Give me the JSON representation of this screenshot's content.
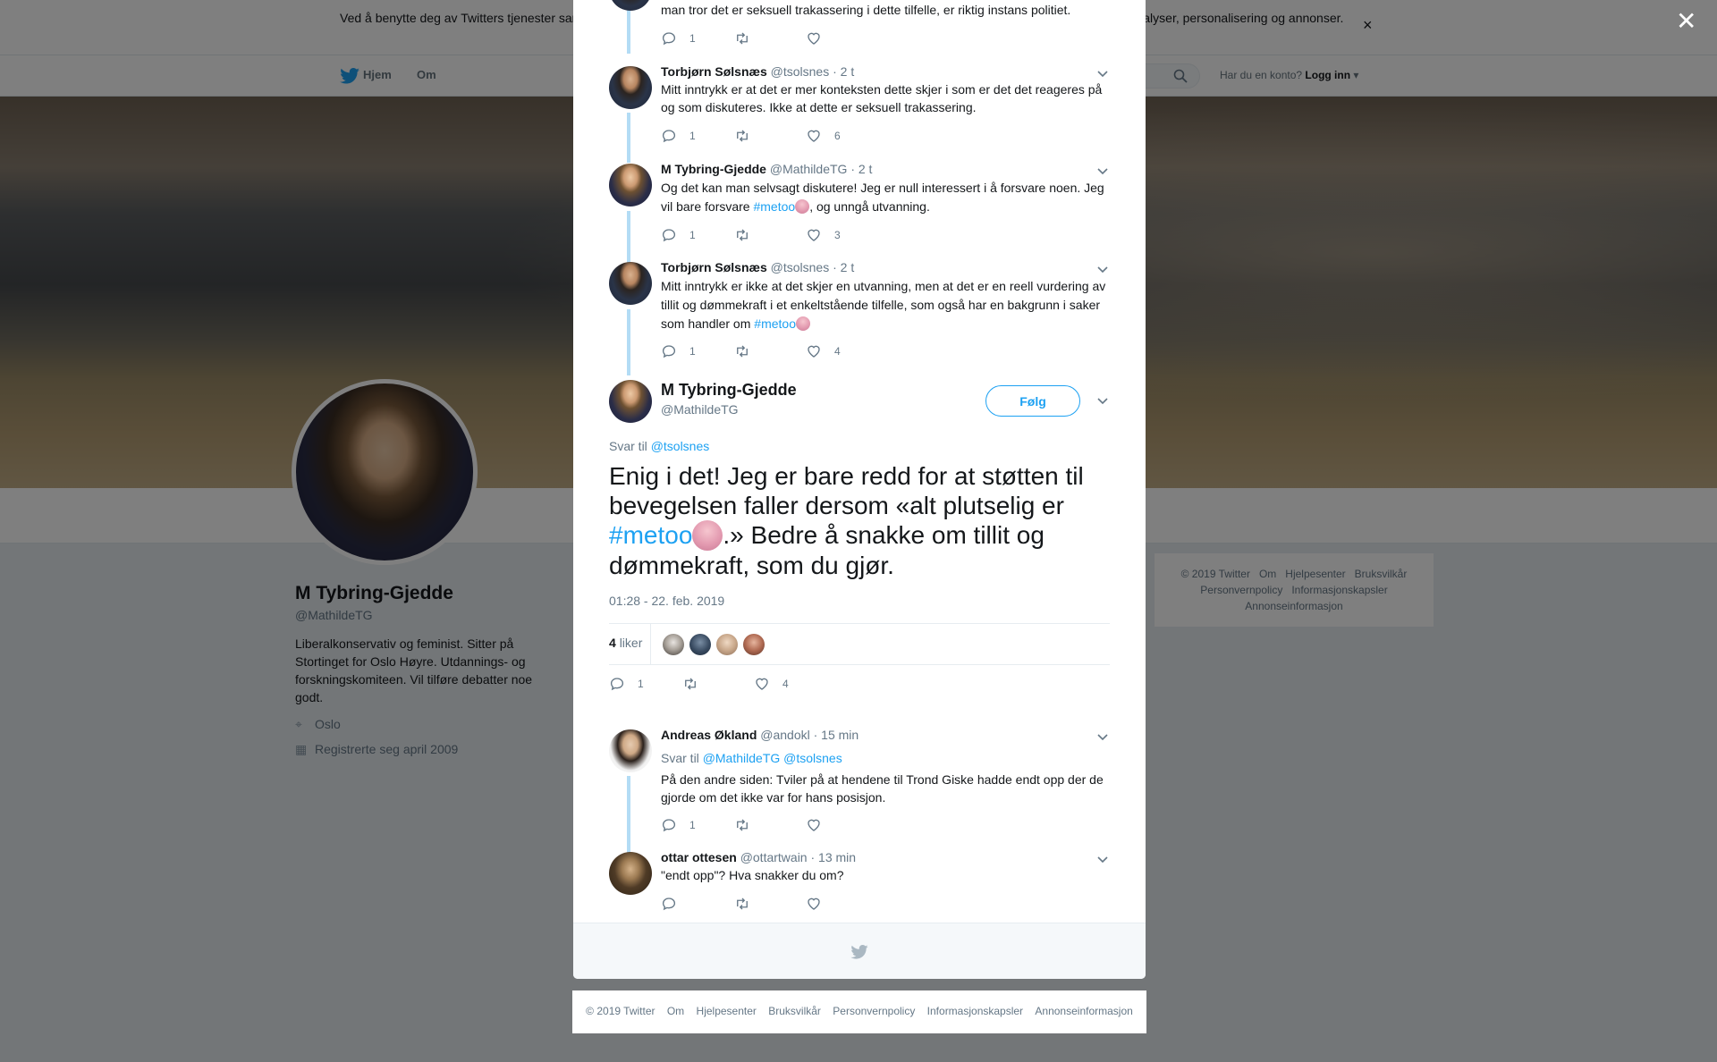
{
  "cookie_bar": {
    "text": "Ved å benytte deg av Twitters tjenester samtykker du i vår bruk av informasjonskapsler. Vi og våre partnere bruker informasjonskapsler til bl.a. analyser, personalisering og annonser.",
    "close": "×"
  },
  "nav": {
    "home": "Hjem",
    "about": "Om",
    "account_prompt": "Har du en konto?",
    "login": "Logg inn"
  },
  "profile": {
    "name": "M Tybring-Gjedde",
    "handle": "@MathildeTG",
    "bio": "Liberalkonservativ og feminist. Sitter på Stortinget for Oslo Høyre. Utdannings- og forskningskomiteen. Vil tilføre debatter noe godt.",
    "location": "Oslo",
    "joined": "Registrerte seg april 2009"
  },
  "side_footer": [
    "© 2019 Twitter",
    "Om",
    "Hjelpesenter",
    "Bruksvilkår",
    "Personvernpolicy",
    "Informasjonskapsler",
    "Annonseinformasjon"
  ],
  "overlay_close": "✕",
  "thread": [
    {
      "text": "man tror det er seksuell trakassering i dette tilfelle, er riktig instans politiet.",
      "replies": "1",
      "retweets": "",
      "likes": ""
    },
    {
      "name": "Torbjørn Sølsnæs",
      "handle": "@tsolsnes",
      "time": "· 2 t",
      "text": "Mitt inntrykk er at det er mer konteksten dette skjer i som er det det reageres på og som diskuteres. Ikke at dette er seksuell trakassering.",
      "replies": "1",
      "retweets": "",
      "likes": "6"
    },
    {
      "name": "M Tybring-Gjedde",
      "handle": "@MathildeTG",
      "time": "· 2 t",
      "text_a": "Og det kan man selvsagt diskutere! Jeg er null interessert i å forsvare noen. Jeg vil bare forsvare ",
      "hashtag": "#metoo",
      "text_b": ", og unngå utvanning.",
      "replies": "1",
      "retweets": "",
      "likes": "3"
    },
    {
      "name": "Torbjørn Sølsnæs",
      "handle": "@tsolsnes",
      "time": "· 2 t",
      "text_a": "Mitt inntrykk er ikke at det skjer en utvanning, men at det er en reell vurdering av tillit og dømmekraft i et enkeltstående tilfelle, som også har en bakgrunn i saker som handler om ",
      "hashtag": "#metoo",
      "replies": "1",
      "retweets": "",
      "likes": "4"
    }
  ],
  "main_tweet": {
    "name": "M Tybring-Gjedde",
    "handle": "@MathildeTG",
    "follow": "Følg",
    "reply_to_label": "Svar til",
    "reply_to_handle": "@tsolsnes",
    "text_a": "Enig i det! Jeg er bare redd for at støtten til bevegelsen faller dersom «alt plutselig er ",
    "hashtag": "#metoo",
    "text_b": ".» Bedre å snakke om tillit og dømmekraft, som du gjør.",
    "timestamp": "01:28 - 22. feb. 2019",
    "likes_count": "4",
    "likes_label": "liker",
    "replies": "1",
    "retweets": "",
    "likes": "4"
  },
  "replies": [
    {
      "name": "Andreas Økland",
      "handle": "@andokl",
      "time": "· 15 min",
      "reply_to_label": "Svar til",
      "reply_to_handles": "@MathildeTG @tsolsnes",
      "text": "På den andre siden: Tviler på at hendene til Trond Giske hadde endt opp der de gjorde om det ikke var for hans posisjon.",
      "replies": "1",
      "retweets": "",
      "likes": ""
    },
    {
      "name": "ottar ottesen",
      "handle": "@ottartwain",
      "time": "· 13 min",
      "text": "\"endt opp\"?  Hva snakker du om?",
      "replies": "",
      "retweets": "",
      "likes": ""
    }
  ],
  "modal_footer": [
    "© 2019 Twitter",
    "Om",
    "Hjelpesenter",
    "Bruksvilkår",
    "Personvernpolicy",
    "Informasjonskapsler",
    "Annonseinformasjon"
  ],
  "icons": {
    "reply": "reply-icon",
    "retweet": "retweet-icon",
    "like": "heart-icon",
    "caret": "chevron-down-icon",
    "bird": "twitter-bird-icon"
  },
  "colors": {
    "accent": "#1da1f2",
    "thread_line": "#b3dcf5",
    "muted": "#657786"
  }
}
